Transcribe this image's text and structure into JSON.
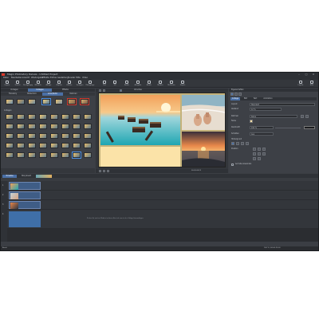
{
  "window": {
    "title": "Magix Photostory Deluxe - Untitled Project",
    "controls": [
      "–",
      "□",
      "×"
    ]
  },
  "menu": [
    "Datei",
    "Bearbeiten",
    "Ansicht",
    "Wiedergabe",
    "Effekte",
    "Extras",
    "Gestaltung",
    "Fenster",
    "Hilfe",
    "Video"
  ],
  "toolbar": {
    "left_buttons": [
      "Import",
      "Schnitt",
      "Rückgängig",
      "Wiederh.",
      "Ablage",
      "Objekte",
      "Effekte",
      "Vorlagen",
      "Übergänge"
    ],
    "center_buttons": [
      "Titel",
      "3D",
      "Audio",
      "Ausgabe",
      "Bearb.",
      "Medien",
      "Multicam",
      "Export"
    ],
    "right_buttons": [
      "Layout",
      "Hilfe"
    ]
  },
  "left_panel": {
    "tabs": [
      "Vorlagen",
      "Collagen",
      "Effekte"
    ],
    "subtabs": [
      "Fotostory",
      "Bildschirm",
      "Intro/Outro",
      "Rahmen"
    ],
    "section_label": "Collagen",
    "thumb_captions": [
      "Layout 1",
      "Layout 2",
      "Layout 3",
      "Layout 4",
      "Layout 5",
      "Layout 6",
      "Layout 7"
    ]
  },
  "preview": {
    "toolbar_label": "Vorschau",
    "time": "00:00:04:12"
  },
  "right_panel": {
    "title": "Eigenschaften",
    "tabs": [
      "Collage",
      "Bild",
      "Text",
      "Animation"
    ],
    "labels": [
      "Layout",
      "Abstand",
      "Rahmen",
      "Farbe",
      "Deckkraft",
      "Schatten",
      "Hintergrund",
      "Position"
    ],
    "values": [
      "Standard",
      "12 %",
      "Keine",
      "",
      "100 %",
      "Aus",
      "Farbe",
      ""
    ],
    "apply_label": "Auf alle anwenden"
  },
  "timeline": {
    "tabs": [
      "Timeline",
      "Storyboard"
    ],
    "track_labels": [
      "1",
      "2",
      "3",
      "4"
    ],
    "hint_text": "Ziehen Sie weitere Medien in diesen Bereich, um sie der Collage hinzuzufügen."
  },
  "status": {
    "left": "Bereit",
    "right": "100 %  |  00:00:15:00"
  },
  "colors": {
    "accent": "#4a6fa5",
    "preview_border": "#c4b27a",
    "app_bg": "#3b3e44"
  }
}
